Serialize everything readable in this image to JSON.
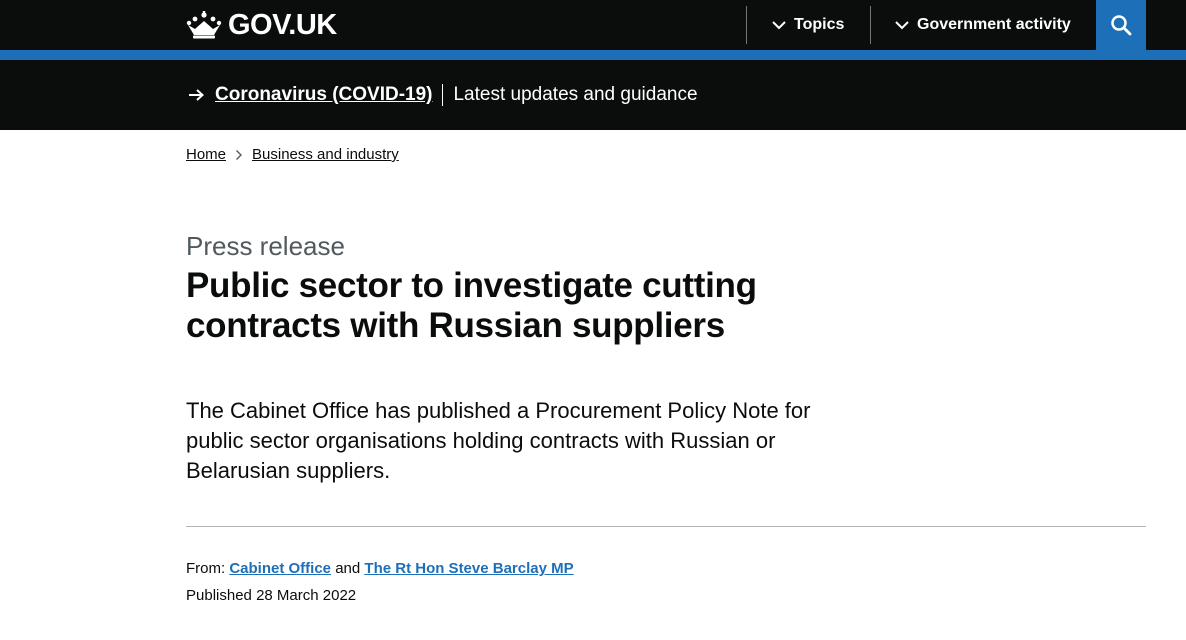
{
  "header": {
    "logo_text": "GOV.UK",
    "nav": [
      {
        "label": "Topics"
      },
      {
        "label": "Government activity"
      }
    ],
    "search_icon": "search-icon",
    "colors": {
      "header_bg": "#0b0c0c",
      "accent": "#1d70b8"
    }
  },
  "banner": {
    "link_text": "Coronavirus (COVID-19)",
    "description": "Latest updates and guidance"
  },
  "breadcrumbs": [
    {
      "label": "Home"
    },
    {
      "label": "Business and industry"
    }
  ],
  "article": {
    "caption": "Press release",
    "title": "Public sector to investigate cutting contracts with Russian suppliers",
    "lead": "The Cabinet Office has published a Procurement Policy Note for public sector organisations holding contracts with Russian or Belarusian suppliers.",
    "meta": {
      "from_label": "From:",
      "from_org": "Cabinet Office",
      "from_joiner": "and",
      "from_person": "The Rt Hon Steve Barclay MP",
      "published_label": "Published",
      "published_date": "28 March 2022"
    }
  }
}
